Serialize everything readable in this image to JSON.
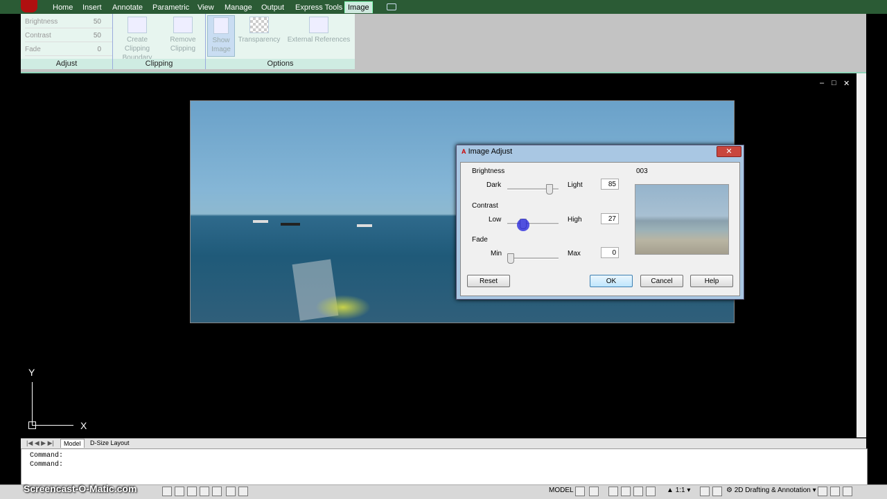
{
  "ribbon": {
    "tabs": [
      "Home",
      "Insert",
      "Annotate",
      "Parametric",
      "View",
      "Manage",
      "Output",
      "Express Tools",
      "Image"
    ],
    "active_tab": "Image",
    "adjust_panel": {
      "title": "Adjust",
      "rows": [
        {
          "label": "Brightness",
          "value": "50"
        },
        {
          "label": "Contrast",
          "value": "50"
        },
        {
          "label": "Fade",
          "value": "0"
        }
      ]
    },
    "clipping_panel": {
      "title": "Clipping",
      "create_label": "Create Clipping Boundary",
      "remove_label": "Remove Clipping"
    },
    "options_panel": {
      "title": "Options",
      "show_image_label": "Show Image",
      "transparency_label": "Transparency",
      "external_refs_label": "External References"
    }
  },
  "drawing": {
    "ucs_x": "X",
    "ucs_y": "Y",
    "window_controls": [
      "–",
      "□",
      "✕"
    ]
  },
  "dialog": {
    "title": "Image Adjust",
    "brightness": {
      "label": "Brightness",
      "low": "Dark",
      "high": "Light",
      "value": "85",
      "level": 0.85
    },
    "contrast": {
      "label": "Contrast",
      "low": "Low",
      "high": "High",
      "value": "27",
      "level": 0.27
    },
    "fade": {
      "label": "Fade",
      "low": "Min",
      "high": "Max",
      "value": "0",
      "level": 0
    },
    "preview_label": "003",
    "buttons": {
      "reset": "Reset",
      "ok": "OK",
      "cancel": "Cancel",
      "help": "Help"
    }
  },
  "layout_tabs": {
    "model": "Model",
    "layout": "D-Size Layout"
  },
  "command": {
    "lines": [
      "Command:",
      "Command:"
    ]
  },
  "status": {
    "model": "MODEL",
    "scale": "1:1",
    "workspace": "2D Drafting & Annotation",
    "watermark": "Screencast-O-Matic.com"
  }
}
